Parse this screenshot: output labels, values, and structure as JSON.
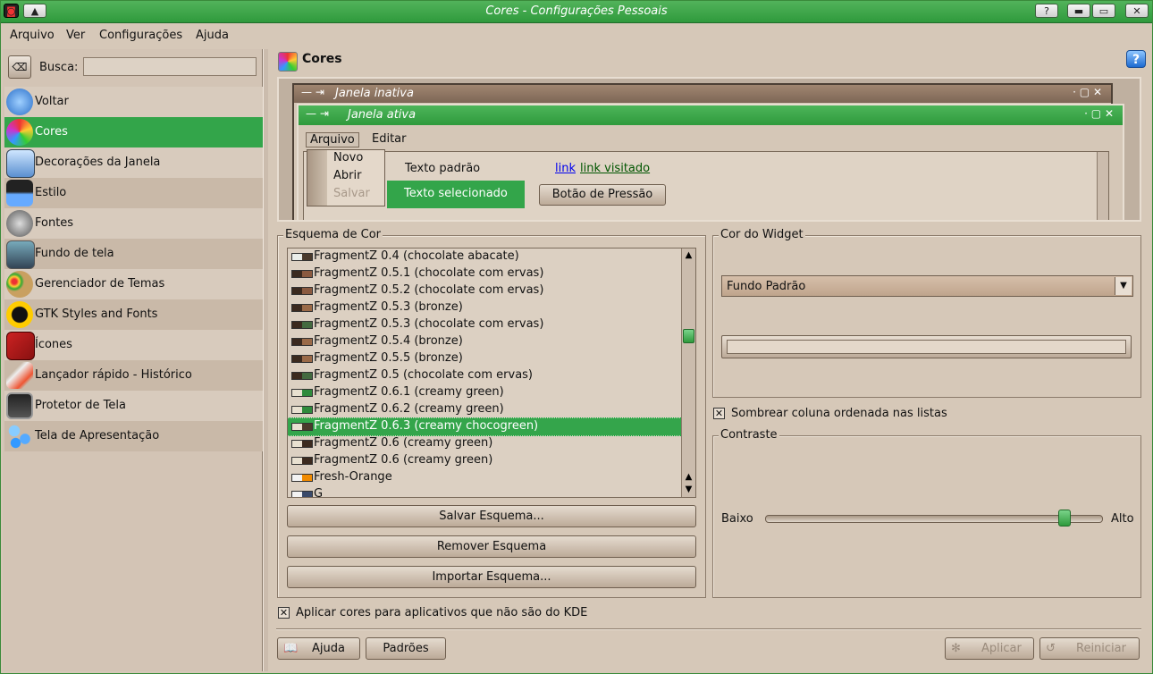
{
  "window": {
    "title": "Cores - Configurações Pessoais"
  },
  "menubar": [
    "Arquivo",
    "Ver",
    "Configurações",
    "Ajuda"
  ],
  "sidebar": {
    "search_label": "Busca:",
    "search_value": "",
    "items": [
      {
        "label": "Voltar",
        "icon": "back-arrow-icon"
      },
      {
        "label": "Cores",
        "icon": "color-wheel-icon",
        "active": true
      },
      {
        "label": "Decorações da Janela",
        "icon": "window-decoration-icon"
      },
      {
        "label": "Estilo",
        "icon": "style-glasses-icon"
      },
      {
        "label": "Fontes",
        "icon": "fonts-icon"
      },
      {
        "label": "Fundo de tela",
        "icon": "wallpaper-icon"
      },
      {
        "label": "Gerenciador de Temas",
        "icon": "palette-icon"
      },
      {
        "label": "GTK Styles and Fonts",
        "icon": "gtk-gnome-icon"
      },
      {
        "label": "Ícones",
        "icon": "icons-icon"
      },
      {
        "label": "Lançador rápido - Histórico",
        "icon": "rocket-icon"
      },
      {
        "label": "Protetor de Tela",
        "icon": "screensaver-icon"
      },
      {
        "label": "Tela de Apresentação",
        "icon": "splash-icon"
      }
    ]
  },
  "page": {
    "title": "Cores"
  },
  "preview": {
    "inactive_title": "Janela inativa",
    "active_title": "Janela ativa",
    "menu": [
      "Arquivo",
      "Editar"
    ],
    "popup_items": [
      "Novo",
      "Abrir",
      "Salvar"
    ],
    "normal_text": "Texto padrão",
    "selected_text": "Texto selecionado",
    "link": "link",
    "visited_link": "link visitado",
    "push_button": "Botão de Pressão"
  },
  "scheme": {
    "group_title": "Esquema de Cor",
    "items": [
      {
        "label": "FragmentZ 0.4 (chocolate abacate)",
        "c1": "#e9ede9",
        "c2": "#4a3a2c"
      },
      {
        "label": "FragmentZ 0.5.1 (chocolate com ervas)",
        "c1": "#3b2a1f",
        "c2": "#8a5a40"
      },
      {
        "label": "FragmentZ 0.5.2 (chocolate com ervas)",
        "c1": "#3b2a1f",
        "c2": "#8a5a40"
      },
      {
        "label": "FragmentZ 0.5.3 (bronze)",
        "c1": "#3b2a1f",
        "c2": "#9a6a48"
      },
      {
        "label": "FragmentZ 0.5.3 (chocolate com ervas)",
        "c1": "#3b2a1f",
        "c2": "#446a40"
      },
      {
        "label": "FragmentZ 0.5.4 (bronze)",
        "c1": "#3b2a1f",
        "c2": "#9a6a48"
      },
      {
        "label": "FragmentZ 0.5.5 (bronze)",
        "c1": "#3b2a1f",
        "c2": "#9a6a48"
      },
      {
        "label": "FragmentZ 0.5 (chocolate com ervas)",
        "c1": "#3b2a1f",
        "c2": "#446a40"
      },
      {
        "label": "FragmentZ 0.6.1 (creamy green)",
        "c1": "#e8e0d0",
        "c2": "#2f8a3c"
      },
      {
        "label": "FragmentZ 0.6.2 (creamy green)",
        "c1": "#e8e0d0",
        "c2": "#2f8a3c"
      },
      {
        "label": "FragmentZ 0.6.3 (creamy chocogreen)",
        "c1": "#e8e0d0",
        "c2": "#4a3a2c",
        "selected": true
      },
      {
        "label": "FragmentZ 0.6 (creamy green)",
        "c1": "#e8e0d0",
        "c2": "#3b2a1f"
      },
      {
        "label": "FragmentZ 0.6 (creamy green)",
        "c1": "#e8e0d0",
        "c2": "#3b2a1f"
      },
      {
        "label": "Fresh-Orange",
        "c1": "#f2f2f2",
        "c2": "#f08a00"
      },
      {
        "label": "G",
        "c1": "#f2f2f2",
        "c2": "#3a4a6a"
      }
    ],
    "save": "Salvar Esquema...",
    "remove": "Remover Esquema",
    "import": "Importar Esquema..."
  },
  "widget": {
    "group_title": "Cor do Widget",
    "dropdown_value": "Fundo Padrão"
  },
  "shade_sorted": {
    "label": "Sombrear coluna ordenada nas listas",
    "checked": true
  },
  "contrast": {
    "group_title": "Contraste",
    "low": "Baixo",
    "high": "Alto",
    "value": 0.9
  },
  "apply_non_kde": {
    "label": "Aplicar cores para aplicativos que não são do KDE",
    "checked": true
  },
  "buttons": {
    "help": "Ajuda",
    "defaults": "Padrões",
    "apply": "Aplicar",
    "reset": "Reiniciar"
  }
}
